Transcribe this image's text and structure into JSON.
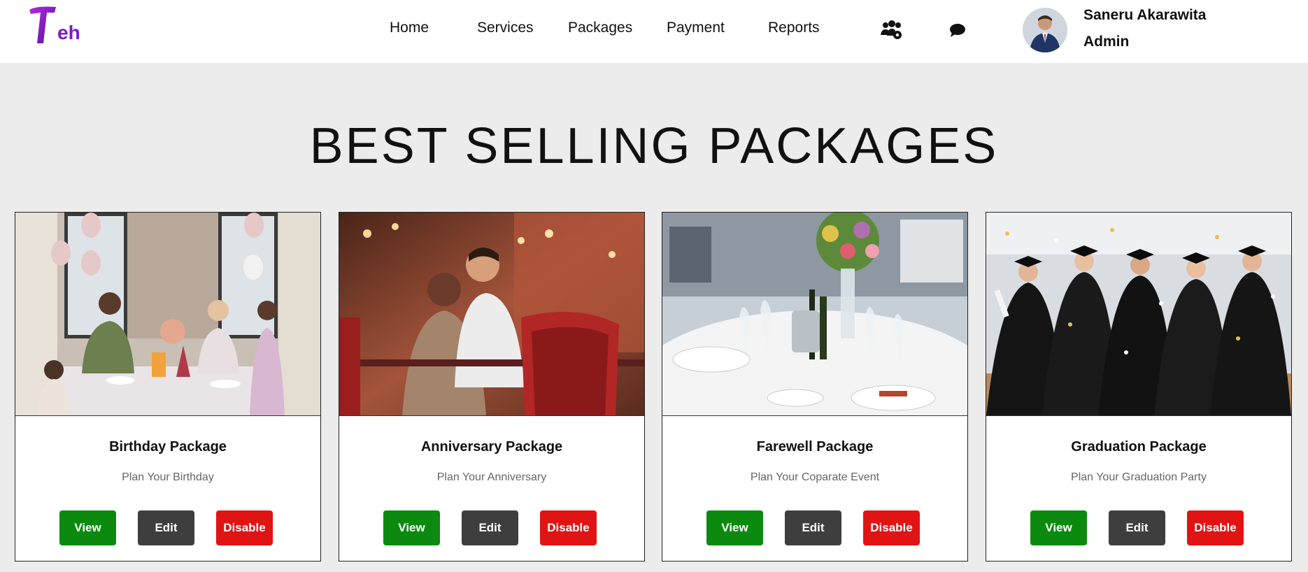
{
  "header": {
    "nav": [
      "Home",
      "Services",
      "Packages",
      "Payment",
      "Reports"
    ],
    "icons": [
      "users-gear-icon",
      "chat-icon"
    ],
    "user": {
      "name": "Saneru Akarawita",
      "role": "Admin"
    }
  },
  "page": {
    "title": "BEST SELLING PACKAGES"
  },
  "buttons": {
    "view": "View",
    "edit": "Edit",
    "disable": "Disable"
  },
  "colors": {
    "view": "#0b8a0f",
    "edit": "#3e3e3e",
    "disable": "#e11414",
    "brand": "#8a1fd1"
  },
  "packages": [
    {
      "title": "Birthday Package",
      "subtitle": "Plan Your Birthday"
    },
    {
      "title": "Anniversary Package",
      "subtitle": "Plan Your Anniversary"
    },
    {
      "title": "Farewell Package",
      "subtitle": "Plan Your Coparate Event"
    },
    {
      "title": "Graduation Package",
      "subtitle": "Plan Your Graduation Party"
    }
  ]
}
